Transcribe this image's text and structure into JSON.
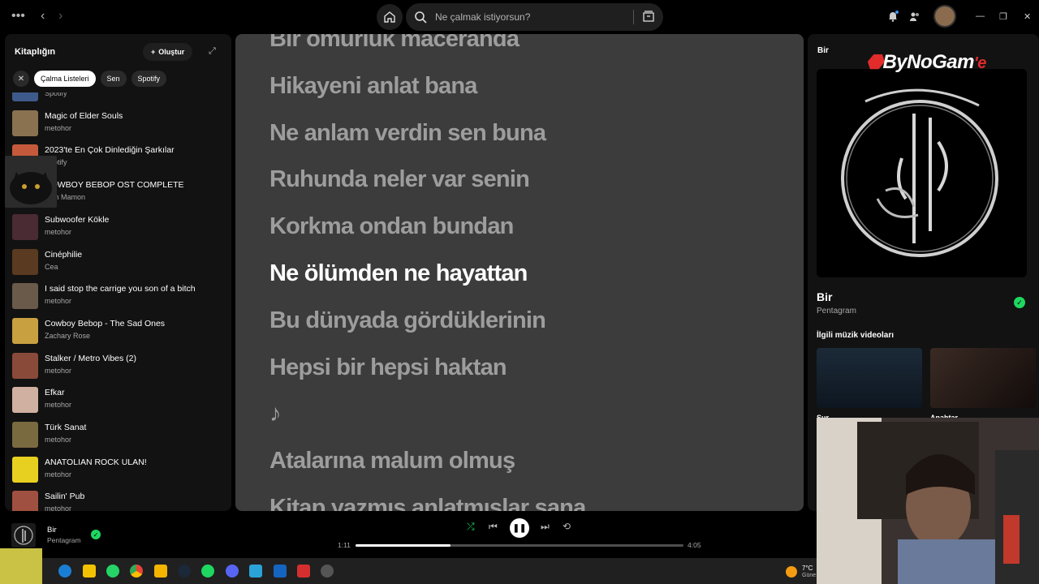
{
  "topbar": {
    "search_placeholder": "Ne çalmak istiyorsun?"
  },
  "library": {
    "title": "Kitaplığın",
    "create_label": "Oluştur",
    "chips": [
      "Çalma Listeleri",
      "Sen",
      "Spotify"
    ],
    "items": [
      {
        "name": "",
        "sub": "Spotify",
        "color": "#3d5a8a"
      },
      {
        "name": "Magic of Elder Souls",
        "sub": "metohor",
        "color": "#8a7250"
      },
      {
        "name": "2023'te En Çok Dinlediğin Şarkılar",
        "sub": "Spotify",
        "color": "#c45a3b"
      },
      {
        "name": "COWBOY BEBOP OST COMPLETE",
        "sub": "Mon Mamon",
        "color": "#2a5fa8"
      },
      {
        "name": "Subwoofer Kökle",
        "sub": "metohor",
        "color": "#4a2a33"
      },
      {
        "name": "Cinéphilie",
        "sub": "Cea",
        "color": "#5a3a20"
      },
      {
        "name": "I said stop the carrige you son of a bitch",
        "sub": "metohor",
        "color": "#6a5a4a"
      },
      {
        "name": "Cowboy Bebop - The Sad Ones",
        "sub": "Zachary Rose",
        "color": "#c9a040"
      },
      {
        "name": "Stalker / Metro Vibes (2)",
        "sub": "metohor",
        "color": "#8a4a3a"
      },
      {
        "name": "Efkar",
        "sub": "metohor",
        "color": "#d0b0a0"
      },
      {
        "name": "Türk Sanat",
        "sub": "metohor",
        "color": "#7a6a40"
      },
      {
        "name": "ANATOLIAN ROCK ULAN!",
        "sub": "metohor",
        "color": "#e8d020"
      },
      {
        "name": "Sailin' Pub",
        "sub": "metohor",
        "color": "#a05040"
      }
    ]
  },
  "lyrics": {
    "lines": [
      {
        "text": "Bir ömürlük maceranda",
        "current": false
      },
      {
        "text": "Hikayeni anlat bana",
        "current": false
      },
      {
        "text": "Ne anlam verdin sen buna",
        "current": false
      },
      {
        "text": "Ruhunda neler var senin",
        "current": false
      },
      {
        "text": "Korkma ondan bundan",
        "current": false
      },
      {
        "text": "Ne ölümden ne hayattan",
        "current": true
      },
      {
        "text": "Bu dünyada gördüklerinin",
        "current": false
      },
      {
        "text": "Hepsi bir hepsi haktan",
        "current": false
      },
      {
        "text": "♪",
        "current": false
      },
      {
        "text": "Atalarına malum olmuş",
        "current": false
      },
      {
        "text": "Kitap yazmış anlatmışlar sana",
        "current": false
      }
    ]
  },
  "right_panel": {
    "title": "Bir",
    "watermark": "ByNoGam",
    "song": "Bir",
    "artist": "Pentagram",
    "related_title": "İlgili müzik videoları",
    "videos": [
      "Sur",
      "Anahtar"
    ]
  },
  "player": {
    "title": "Bir",
    "artist": "Pentagram",
    "elapsed": "1:11",
    "duration": "4:05",
    "progress": 0.29
  },
  "weather": {
    "temp": "7°C",
    "cond": "Güne"
  }
}
